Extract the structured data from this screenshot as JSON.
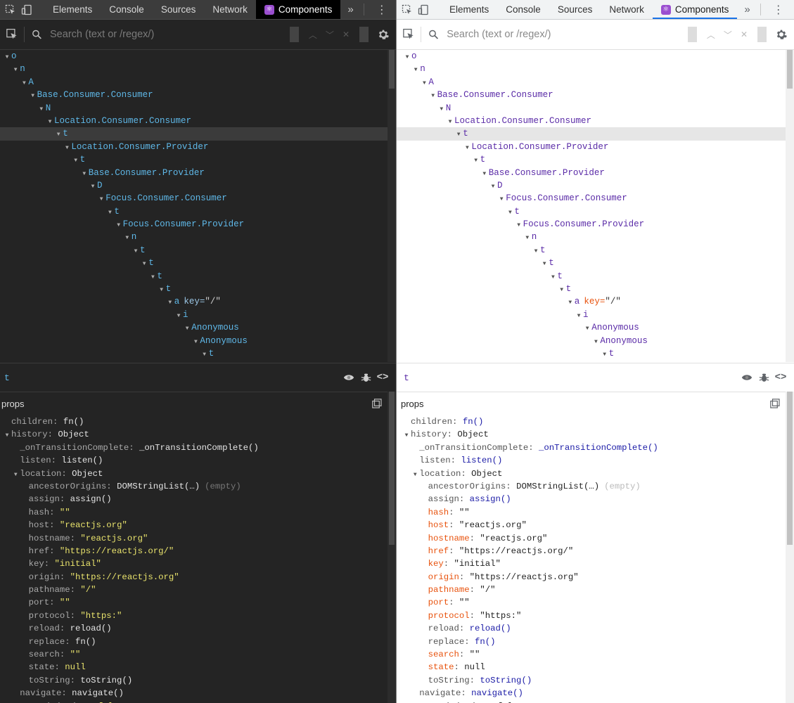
{
  "tabs": {
    "elements": "Elements",
    "console": "Console",
    "sources": "Sources",
    "network": "Network",
    "components": "Components",
    "more": "»"
  },
  "search": {
    "placeholder": "Search (text or /regex/)"
  },
  "tree": [
    {
      "name": "o"
    },
    {
      "name": "n"
    },
    {
      "name": "A"
    },
    {
      "name": "Base.Consumer.Consumer"
    },
    {
      "name": "N"
    },
    {
      "name": "Location.Consumer.Consumer"
    },
    {
      "name": "t",
      "selected": true
    },
    {
      "name": "Location.Consumer.Provider"
    },
    {
      "name": "t"
    },
    {
      "name": "Base.Consumer.Provider"
    },
    {
      "name": "D"
    },
    {
      "name": "Focus.Consumer.Consumer"
    },
    {
      "name": "t"
    },
    {
      "name": "Focus.Consumer.Provider"
    },
    {
      "name": "n"
    },
    {
      "name": "t"
    },
    {
      "name": "t"
    },
    {
      "name": "t"
    },
    {
      "name": "t"
    },
    {
      "name": "a",
      "attr_key": "key",
      "attr_val": "\"/\""
    },
    {
      "name": "i"
    },
    {
      "name": "Anonymous"
    },
    {
      "name": "Anonymous"
    },
    {
      "name": "t"
    }
  ],
  "selected_component": "t",
  "props": {
    "header": "props",
    "rows": [
      {
        "key": "children",
        "value": "fn()",
        "vtype": "fn"
      },
      {
        "key": "history",
        "value": "Object",
        "vtype": "obj",
        "expand": true
      },
      {
        "key": "_onTransitionComplete",
        "value": "_onTransitionComplete()",
        "vtype": "fn"
      },
      {
        "key": "listen",
        "value": "listen()",
        "vtype": "fn"
      },
      {
        "key": "location",
        "value": "Object",
        "vtype": "obj",
        "expand": true
      },
      {
        "key": "ancestorOrigins",
        "value": "DOMStringList(…)",
        "vtype": "obj",
        "note": "(empty)"
      },
      {
        "key": "assign",
        "value": "assign()",
        "vtype": "fn"
      },
      {
        "key": "hash",
        "value": "\"\"",
        "vtype": "str",
        "hl": true
      },
      {
        "key": "host",
        "value": "\"reactjs.org\"",
        "vtype": "str",
        "hl": true
      },
      {
        "key": "hostname",
        "value": "\"reactjs.org\"",
        "vtype": "str",
        "hl": true
      },
      {
        "key": "href",
        "value": "\"https://reactjs.org/\"",
        "vtype": "str",
        "hl": true
      },
      {
        "key": "key",
        "value": "\"initial\"",
        "vtype": "str",
        "hl": true
      },
      {
        "key": "origin",
        "value": "\"https://reactjs.org\"",
        "vtype": "str",
        "hl": true
      },
      {
        "key": "pathname",
        "value": "\"/\"",
        "vtype": "str",
        "hl": true
      },
      {
        "key": "port",
        "value": "\"\"",
        "vtype": "str",
        "hl": true
      },
      {
        "key": "protocol",
        "value": "\"https:\"",
        "vtype": "str",
        "hl": true
      },
      {
        "key": "reload",
        "value": "reload()",
        "vtype": "fn"
      },
      {
        "key": "replace",
        "value": "fn()",
        "vtype": "fn"
      },
      {
        "key": "search",
        "value": "\"\"",
        "vtype": "str",
        "hl": true
      },
      {
        "key": "state",
        "value": "null",
        "vtype": "null",
        "hl": true
      },
      {
        "key": "toString",
        "value": "toString()",
        "vtype": "fn"
      },
      {
        "key": "navigate",
        "value": "navigate()",
        "vtype": "fn"
      },
      {
        "key": "transitioning",
        "value": "false",
        "vtype": "bool"
      }
    ]
  },
  "colors": {
    "dark_bg": "#242424",
    "dark_component": "#5fb8e8",
    "light_component": "#5a2ba7",
    "light_highlight_key": "#e8530e",
    "dark_string": "#e9e36c",
    "react_logo": "#9b4fd0"
  },
  "icons": [
    "element-picker-icon",
    "device-toggle-icon",
    "react-logo-icon",
    "kebab-menu-icon",
    "close-icon",
    "search-icon",
    "chevron-up-icon",
    "chevron-down-icon",
    "clear-icon",
    "gear-icon",
    "eye-icon",
    "bug-icon",
    "code-icon",
    "copy-icon"
  ]
}
